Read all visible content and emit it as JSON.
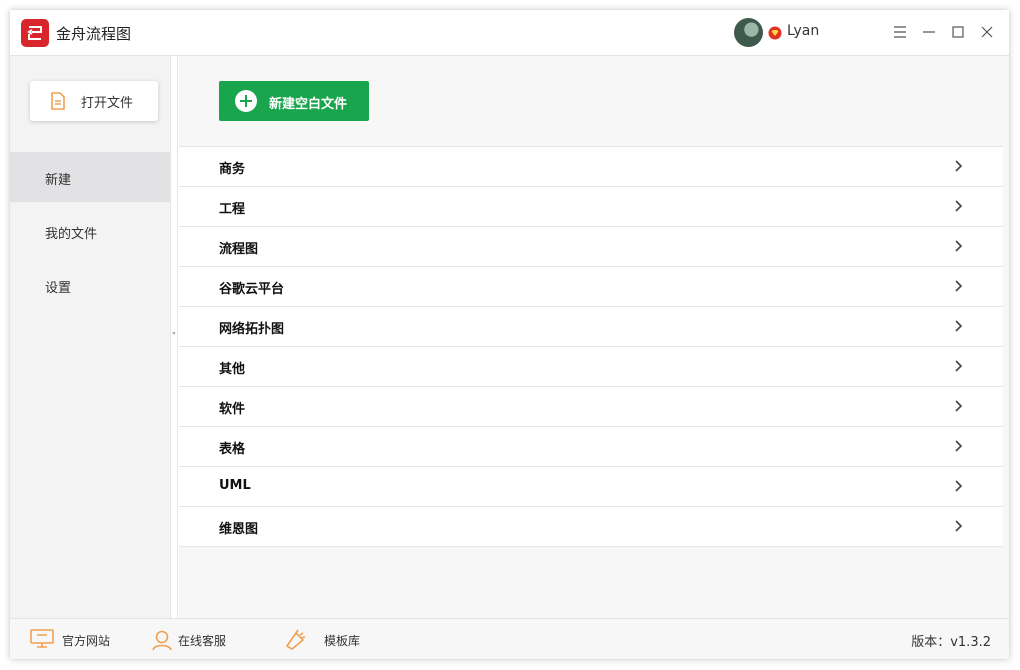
{
  "app": {
    "title": "金舟流程图"
  },
  "user": {
    "name": "Lyan"
  },
  "sidebar": {
    "open_file": "打开文件",
    "items": [
      {
        "label": "新建",
        "active": true
      },
      {
        "label": "我的文件",
        "active": false
      },
      {
        "label": "设置",
        "active": false
      }
    ]
  },
  "main": {
    "new_blank": "新建空白文件",
    "categories": [
      "商务",
      "工程",
      "流程图",
      "谷歌云平台",
      "网络拓扑图",
      "其他",
      "软件",
      "表格",
      "UML",
      "维恩图"
    ]
  },
  "footer": {
    "website": "官方网站",
    "support": "在线客服",
    "templates": "模板库",
    "version": "版本：v1.3.2"
  },
  "colors": {
    "brand": "#d8262c",
    "accent": "#19a54d",
    "icon_orange": "#f0a050"
  }
}
